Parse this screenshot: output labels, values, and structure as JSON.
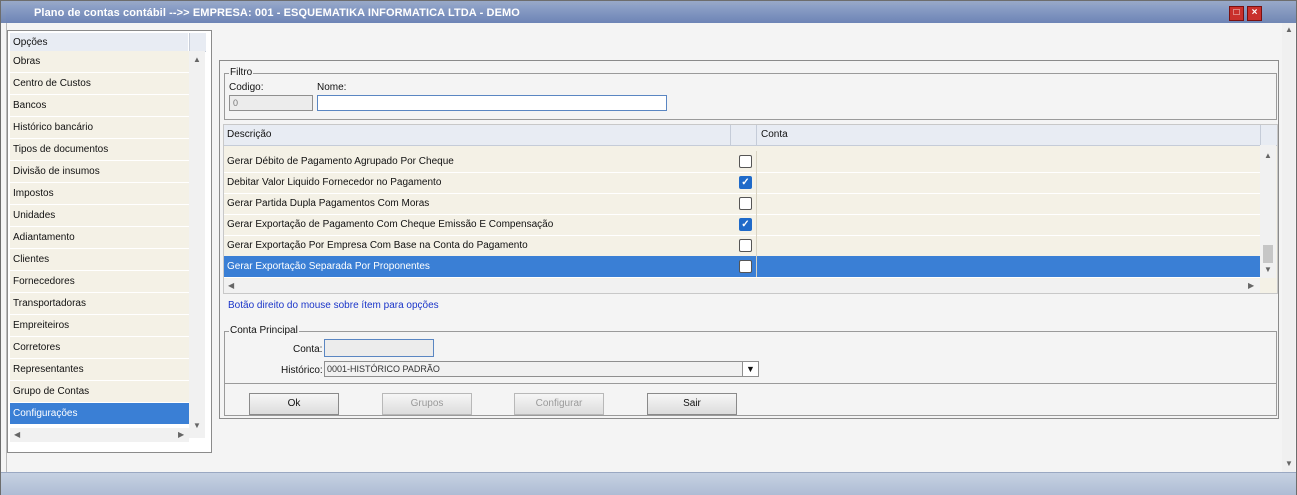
{
  "window": {
    "title": "Plano de contas contábil -->> EMPRESA: 001 - ESQUEMATIKA INFORMATICA LTDA - DEMO"
  },
  "sidebar": {
    "header": "Opções",
    "items": [
      {
        "label": "Obras"
      },
      {
        "label": "Centro de Custos"
      },
      {
        "label": "Bancos"
      },
      {
        "label": "Histórico bancário"
      },
      {
        "label": "Tipos de documentos"
      },
      {
        "label": "Divisão de insumos"
      },
      {
        "label": "Impostos"
      },
      {
        "label": "Unidades"
      },
      {
        "label": "Adiantamento"
      },
      {
        "label": "Clientes"
      },
      {
        "label": "Fornecedores"
      },
      {
        "label": "Transportadoras"
      },
      {
        "label": "Empreiteiros"
      },
      {
        "label": "Corretores"
      },
      {
        "label": "Representantes"
      },
      {
        "label": "Grupo de Contas"
      },
      {
        "label": "Configurações",
        "selected": true
      }
    ]
  },
  "filtro": {
    "legend": "Filtro",
    "codigo_label": "Codigo:",
    "codigo_value": "0",
    "nome_label": "Nome:",
    "nome_value": ""
  },
  "grid": {
    "columns": [
      "Descrição",
      "Conta"
    ],
    "rows": [
      {
        "descricao": "Gerar Débito de Pagamento Agrupado Por Cheque",
        "checked": false,
        "conta": ""
      },
      {
        "descricao": "Debitar Valor Liquido Fornecedor no Pagamento",
        "checked": true,
        "conta": ""
      },
      {
        "descricao": "Gerar Partida Dupla Pagamentos Com Moras",
        "checked": false,
        "conta": ""
      },
      {
        "descricao": "Gerar Exportação de Pagamento Com Cheque Emissão E Compensação",
        "checked": true,
        "conta": ""
      },
      {
        "descricao": "Gerar Exportação Por Empresa Com Base na Conta do Pagamento",
        "checked": false,
        "conta": ""
      },
      {
        "descricao": "Gerar Exportação Separada Por Proponentes",
        "checked": false,
        "conta": "",
        "selected": true
      }
    ],
    "hint": "Botão direito do mouse sobre ítem para opções"
  },
  "conta_principal": {
    "legend": "Conta Principal",
    "conta_label": "Conta:",
    "conta_value": "",
    "historico_label": "Histórico:",
    "historico_value": "0001-HISTÓRICO PADRÃO"
  },
  "buttons": {
    "ok": "Ok",
    "grupos": "Grupos",
    "configurar": "Configurar",
    "sair": "Sair"
  },
  "colors": {
    "selection": "#3a7fd5",
    "row_bg": "#f4f1e6",
    "title_bar": "#7187b4",
    "hint_text": "#1a35c9"
  }
}
